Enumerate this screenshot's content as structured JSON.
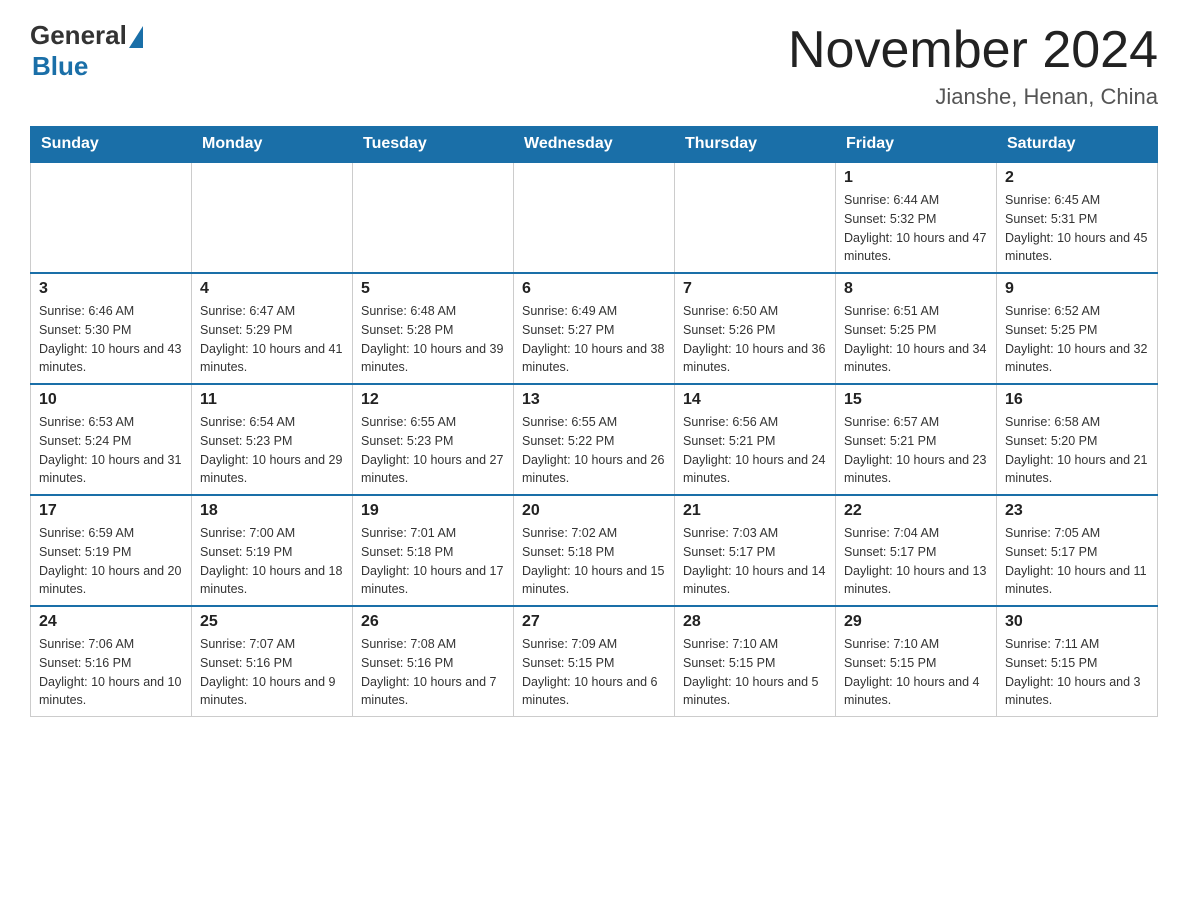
{
  "header": {
    "logo_general": "General",
    "logo_blue": "Blue",
    "month_title": "November 2024",
    "location": "Jianshe, Henan, China"
  },
  "weekdays": [
    "Sunday",
    "Monday",
    "Tuesday",
    "Wednesday",
    "Thursday",
    "Friday",
    "Saturday"
  ],
  "weeks": [
    [
      {
        "day": "",
        "info": ""
      },
      {
        "day": "",
        "info": ""
      },
      {
        "day": "",
        "info": ""
      },
      {
        "day": "",
        "info": ""
      },
      {
        "day": "",
        "info": ""
      },
      {
        "day": "1",
        "info": "Sunrise: 6:44 AM\nSunset: 5:32 PM\nDaylight: 10 hours and 47 minutes."
      },
      {
        "day": "2",
        "info": "Sunrise: 6:45 AM\nSunset: 5:31 PM\nDaylight: 10 hours and 45 minutes."
      }
    ],
    [
      {
        "day": "3",
        "info": "Sunrise: 6:46 AM\nSunset: 5:30 PM\nDaylight: 10 hours and 43 minutes."
      },
      {
        "day": "4",
        "info": "Sunrise: 6:47 AM\nSunset: 5:29 PM\nDaylight: 10 hours and 41 minutes."
      },
      {
        "day": "5",
        "info": "Sunrise: 6:48 AM\nSunset: 5:28 PM\nDaylight: 10 hours and 39 minutes."
      },
      {
        "day": "6",
        "info": "Sunrise: 6:49 AM\nSunset: 5:27 PM\nDaylight: 10 hours and 38 minutes."
      },
      {
        "day": "7",
        "info": "Sunrise: 6:50 AM\nSunset: 5:26 PM\nDaylight: 10 hours and 36 minutes."
      },
      {
        "day": "8",
        "info": "Sunrise: 6:51 AM\nSunset: 5:25 PM\nDaylight: 10 hours and 34 minutes."
      },
      {
        "day": "9",
        "info": "Sunrise: 6:52 AM\nSunset: 5:25 PM\nDaylight: 10 hours and 32 minutes."
      }
    ],
    [
      {
        "day": "10",
        "info": "Sunrise: 6:53 AM\nSunset: 5:24 PM\nDaylight: 10 hours and 31 minutes."
      },
      {
        "day": "11",
        "info": "Sunrise: 6:54 AM\nSunset: 5:23 PM\nDaylight: 10 hours and 29 minutes."
      },
      {
        "day": "12",
        "info": "Sunrise: 6:55 AM\nSunset: 5:23 PM\nDaylight: 10 hours and 27 minutes."
      },
      {
        "day": "13",
        "info": "Sunrise: 6:55 AM\nSunset: 5:22 PM\nDaylight: 10 hours and 26 minutes."
      },
      {
        "day": "14",
        "info": "Sunrise: 6:56 AM\nSunset: 5:21 PM\nDaylight: 10 hours and 24 minutes."
      },
      {
        "day": "15",
        "info": "Sunrise: 6:57 AM\nSunset: 5:21 PM\nDaylight: 10 hours and 23 minutes."
      },
      {
        "day": "16",
        "info": "Sunrise: 6:58 AM\nSunset: 5:20 PM\nDaylight: 10 hours and 21 minutes."
      }
    ],
    [
      {
        "day": "17",
        "info": "Sunrise: 6:59 AM\nSunset: 5:19 PM\nDaylight: 10 hours and 20 minutes."
      },
      {
        "day": "18",
        "info": "Sunrise: 7:00 AM\nSunset: 5:19 PM\nDaylight: 10 hours and 18 minutes."
      },
      {
        "day": "19",
        "info": "Sunrise: 7:01 AM\nSunset: 5:18 PM\nDaylight: 10 hours and 17 minutes."
      },
      {
        "day": "20",
        "info": "Sunrise: 7:02 AM\nSunset: 5:18 PM\nDaylight: 10 hours and 15 minutes."
      },
      {
        "day": "21",
        "info": "Sunrise: 7:03 AM\nSunset: 5:17 PM\nDaylight: 10 hours and 14 minutes."
      },
      {
        "day": "22",
        "info": "Sunrise: 7:04 AM\nSunset: 5:17 PM\nDaylight: 10 hours and 13 minutes."
      },
      {
        "day": "23",
        "info": "Sunrise: 7:05 AM\nSunset: 5:17 PM\nDaylight: 10 hours and 11 minutes."
      }
    ],
    [
      {
        "day": "24",
        "info": "Sunrise: 7:06 AM\nSunset: 5:16 PM\nDaylight: 10 hours and 10 minutes."
      },
      {
        "day": "25",
        "info": "Sunrise: 7:07 AM\nSunset: 5:16 PM\nDaylight: 10 hours and 9 minutes."
      },
      {
        "day": "26",
        "info": "Sunrise: 7:08 AM\nSunset: 5:16 PM\nDaylight: 10 hours and 7 minutes."
      },
      {
        "day": "27",
        "info": "Sunrise: 7:09 AM\nSunset: 5:15 PM\nDaylight: 10 hours and 6 minutes."
      },
      {
        "day": "28",
        "info": "Sunrise: 7:10 AM\nSunset: 5:15 PM\nDaylight: 10 hours and 5 minutes."
      },
      {
        "day": "29",
        "info": "Sunrise: 7:10 AM\nSunset: 5:15 PM\nDaylight: 10 hours and 4 minutes."
      },
      {
        "day": "30",
        "info": "Sunrise: 7:11 AM\nSunset: 5:15 PM\nDaylight: 10 hours and 3 minutes."
      }
    ]
  ]
}
